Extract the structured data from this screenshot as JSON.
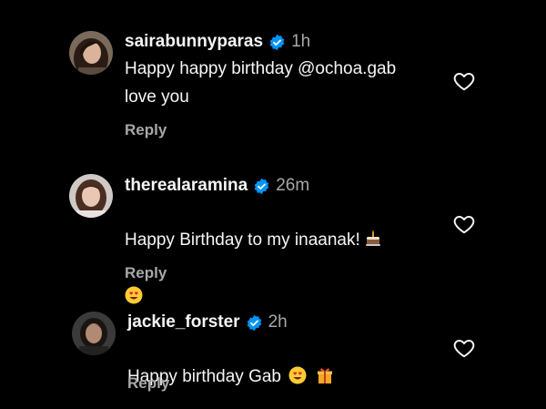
{
  "colors": {
    "background": "#000000",
    "primary_text": "#f5f5f5",
    "secondary_text": "#a8a8a8",
    "verified_badge": "#0095f6"
  },
  "comments": [
    {
      "username": "sairabunnyparas",
      "verified": true,
      "time": "1h",
      "text": "Happy happy birthday @ochoa.gab\nlove you",
      "emojis": [],
      "reply_label": "Reply",
      "like_icon": "heart-outline-icon"
    },
    {
      "username": "therealaramina",
      "verified": true,
      "time": "26m",
      "text": "Happy Birthday to my inaanak!",
      "emojis": [
        "birthday-cake-emoji",
        "heart-eyes-emoji"
      ],
      "reply_label": "Reply",
      "like_icon": "heart-outline-icon"
    },
    {
      "username": "jackie_forster",
      "verified": true,
      "time": "2h",
      "text": "Happy birthday Gab",
      "emojis": [
        "heart-eyes-emoji",
        "gift-emoji"
      ],
      "reply_label": "Reply",
      "like_icon": "heart-outline-icon"
    }
  ]
}
